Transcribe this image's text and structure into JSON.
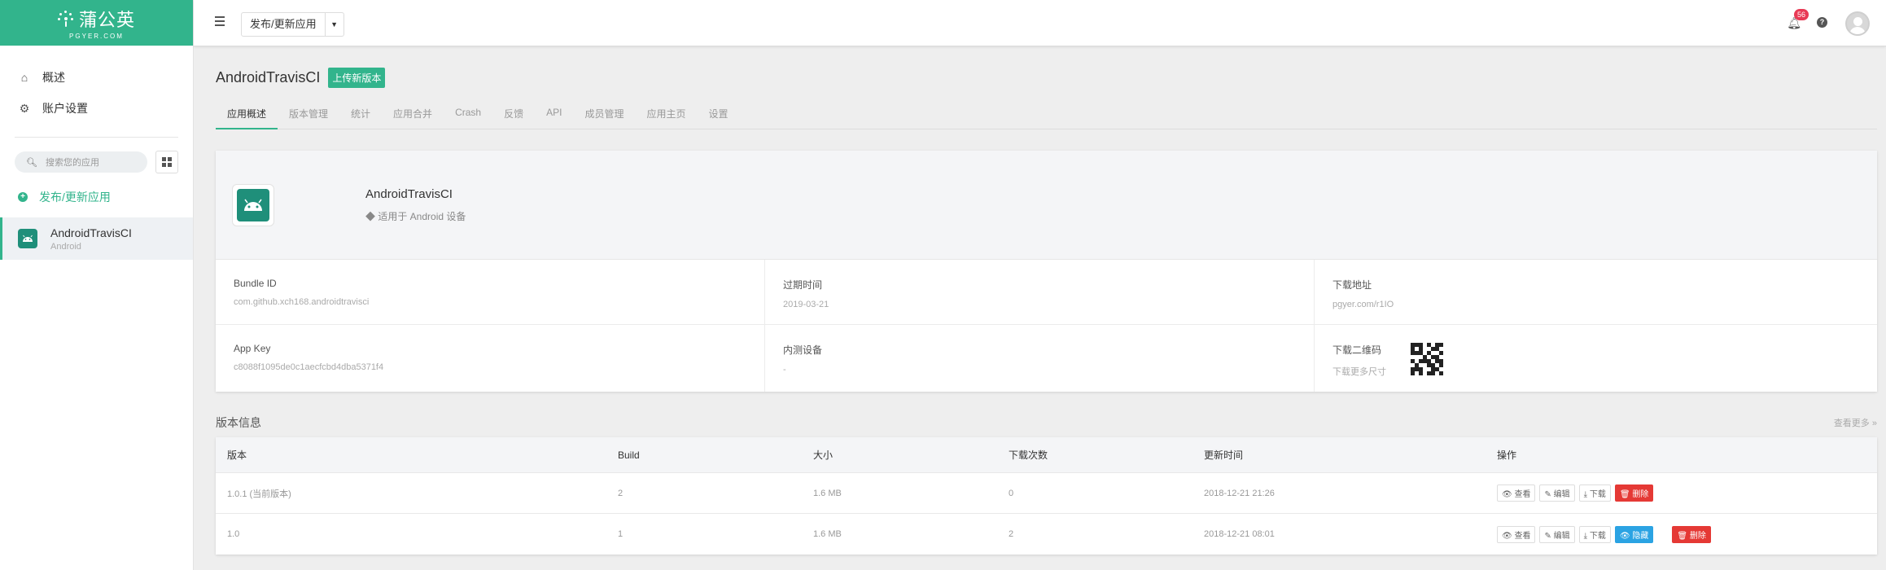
{
  "logo": {
    "main": "蒲公英",
    "sub": "PGYER.COM"
  },
  "sidebar": {
    "nav": [
      {
        "label": "概述",
        "icon": "home-icon"
      },
      {
        "label": "账户设置",
        "icon": "gear-icon"
      }
    ],
    "search_placeholder": "搜索您的应用",
    "publish_label": "发布/更新应用",
    "app": {
      "name": "AndroidTravisCI",
      "platform": "Android"
    }
  },
  "header": {
    "dropdown_label": "发布/更新应用",
    "notification_count": "56"
  },
  "main": {
    "app_title": "AndroidTravisCI",
    "upload_label": "上传新版本",
    "tabs": [
      "应用概述",
      "版本管理",
      "统计",
      "应用合并",
      "Crash",
      "反馈",
      "API",
      "成员管理",
      "应用主页",
      "设置"
    ],
    "card": {
      "name": "AndroidTravisCI",
      "platform_note": "◆ 适用于 Android 设备",
      "fields": [
        {
          "label": "Bundle ID",
          "value": "com.github.xch168.androidtravisci"
        },
        {
          "label": "过期时间",
          "value": "2019-03-21"
        },
        {
          "label": "下载地址",
          "value": "pgyer.com/r1IO"
        },
        {
          "label": "App Key",
          "value": "c8088f1095de0c1aecfcbd4dba5371f4"
        },
        {
          "label": "内测设备",
          "value": "-"
        },
        {
          "label": "下载二维码",
          "value": "下载更多尺寸"
        }
      ]
    },
    "versions": {
      "title": "版本信息",
      "more_label": "查看更多 »",
      "columns": [
        "版本",
        "Build",
        "大小",
        "下载次数",
        "更新时间",
        "操作"
      ],
      "rows": [
        {
          "version": "1.0.1 (当前版本)",
          "build": "2",
          "size": "1.6 MB",
          "downloads": "0",
          "updated": "2018-12-21 21:26"
        },
        {
          "version": "1.0",
          "build": "1",
          "size": "1.6 MB",
          "downloads": "2",
          "updated": "2018-12-21 08:01"
        }
      ],
      "actions": {
        "view": "查看",
        "edit": "编辑",
        "download": "下载",
        "hide": "隐藏",
        "delete": "删除"
      }
    }
  },
  "colors": {
    "brand": "#32b48c",
    "danger": "#e53935",
    "info": "#2ba3e3",
    "badge": "#e83a55"
  }
}
